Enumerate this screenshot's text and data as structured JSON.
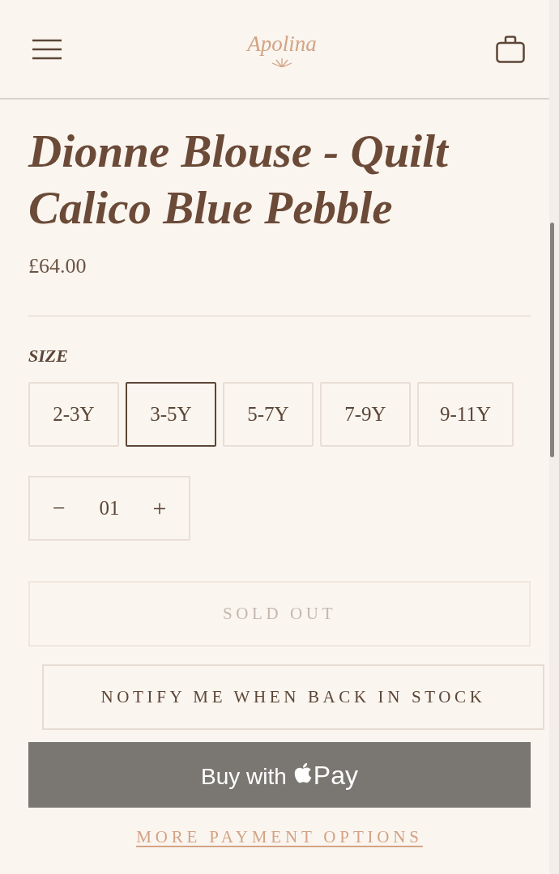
{
  "header": {
    "logo": "Apolina"
  },
  "product": {
    "title": "Dionne Blouse - Quilt Calico Blue Pebble",
    "price": "£64.00"
  },
  "size": {
    "label": "SIZE",
    "options": [
      {
        "label": "2-3Y",
        "selected": false
      },
      {
        "label": "3-5Y",
        "selected": true
      },
      {
        "label": "5-7Y",
        "selected": false
      },
      {
        "label": "7-9Y",
        "selected": false
      },
      {
        "label": "9-11Y",
        "selected": false
      }
    ]
  },
  "quantity": {
    "decrease": "−",
    "value": "01",
    "increase": "+"
  },
  "buttons": {
    "sold_out": {
      "label": "SOLD OUT",
      "disabled": true
    },
    "notify": {
      "label": "NOTIFY ME WHEN BACK IN STOCK"
    },
    "apple_pay": {
      "prefix": "Buy with",
      "suffix": "Pay"
    },
    "more_options": {
      "label": "MORE PAYMENT OPTIONS"
    }
  }
}
